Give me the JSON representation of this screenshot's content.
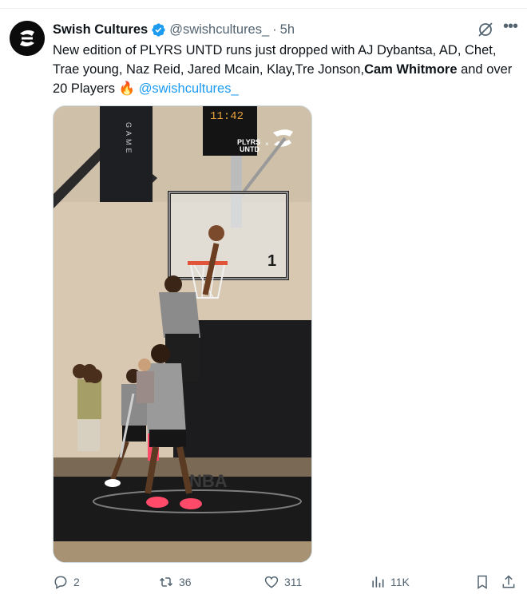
{
  "author": {
    "display_name": "Swish Cultures",
    "handle": "@swishcultures_",
    "separator": "·",
    "time": "5h"
  },
  "tweet": {
    "text_1": "New edition of PLYRS UNTD runs just dropped with AJ Dybantsa, AD, Chet, Trae young, Naz Reid, Jared Mcain, Klay,Tre Jonson,",
    "bold": "Cam Whitmore",
    "text_2": " and over 20 Players ",
    "emoji": "🔥",
    "mention": "@swishcultures_"
  },
  "media": {
    "banner_text": "GAME",
    "scoreboard": "11:42",
    "watermark_1": "PLYRS",
    "watermark_2": "UNTD",
    "watermark_x": "×",
    "backboard_number": "1"
  },
  "actions": {
    "replies": "2",
    "reposts": "36",
    "likes": "311",
    "views": "11K"
  },
  "colors": {
    "accent": "#1d9bf0",
    "muted": "#536471",
    "text": "#0f1419"
  }
}
